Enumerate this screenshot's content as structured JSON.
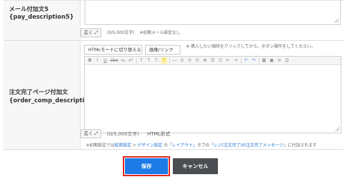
{
  "mail_field": {
    "label_line1": "メール付加文5",
    "label_line2": "{pay_description5}",
    "expand_label": "広く",
    "char_count": "(0/5,000文字)",
    "initial_note": "※初期メール設定なし"
  },
  "order_field": {
    "label_line1": "注文完了ページ付加文",
    "label_line2": "{order_comp_description}",
    "tab_html": "HTMLモードに切り替える",
    "tab_image": "画像/リンク",
    "tab_hint": "※ 挿入したい個所をクリックしてから、ボタン操作をしてください。",
    "expand_label": "広く",
    "char_count": "(0/5,000文字)",
    "format_label": "HTML形式",
    "note_prefix": "※初期設定では",
    "note_link1": "拡張設定",
    "note_mid1": " > ",
    "note_link2": "デザイン設定",
    "note_mid2": " の",
    "note_link3": "「レイアウト」",
    "note_mid3": "タブの",
    "note_link4": "「レジ(注文完了)の注文完了メッセージ」",
    "note_suffix": "に付加されます"
  },
  "toolbar": {
    "bold": "B",
    "italic": "I",
    "underline": "U",
    "strike": "abc",
    "subscript": "x₂",
    "superscript": "x²",
    "font_size": "T",
    "font_color": "T",
    "highlight": "T"
  },
  "actions": {
    "save_label": "保存",
    "cancel_label": "キャンセル"
  },
  "colors": {
    "accent": "#1e7ae6",
    "highlight_border": "#e2231a",
    "cancel_bg": "#4a4d52",
    "link": "#1a6fd1"
  }
}
